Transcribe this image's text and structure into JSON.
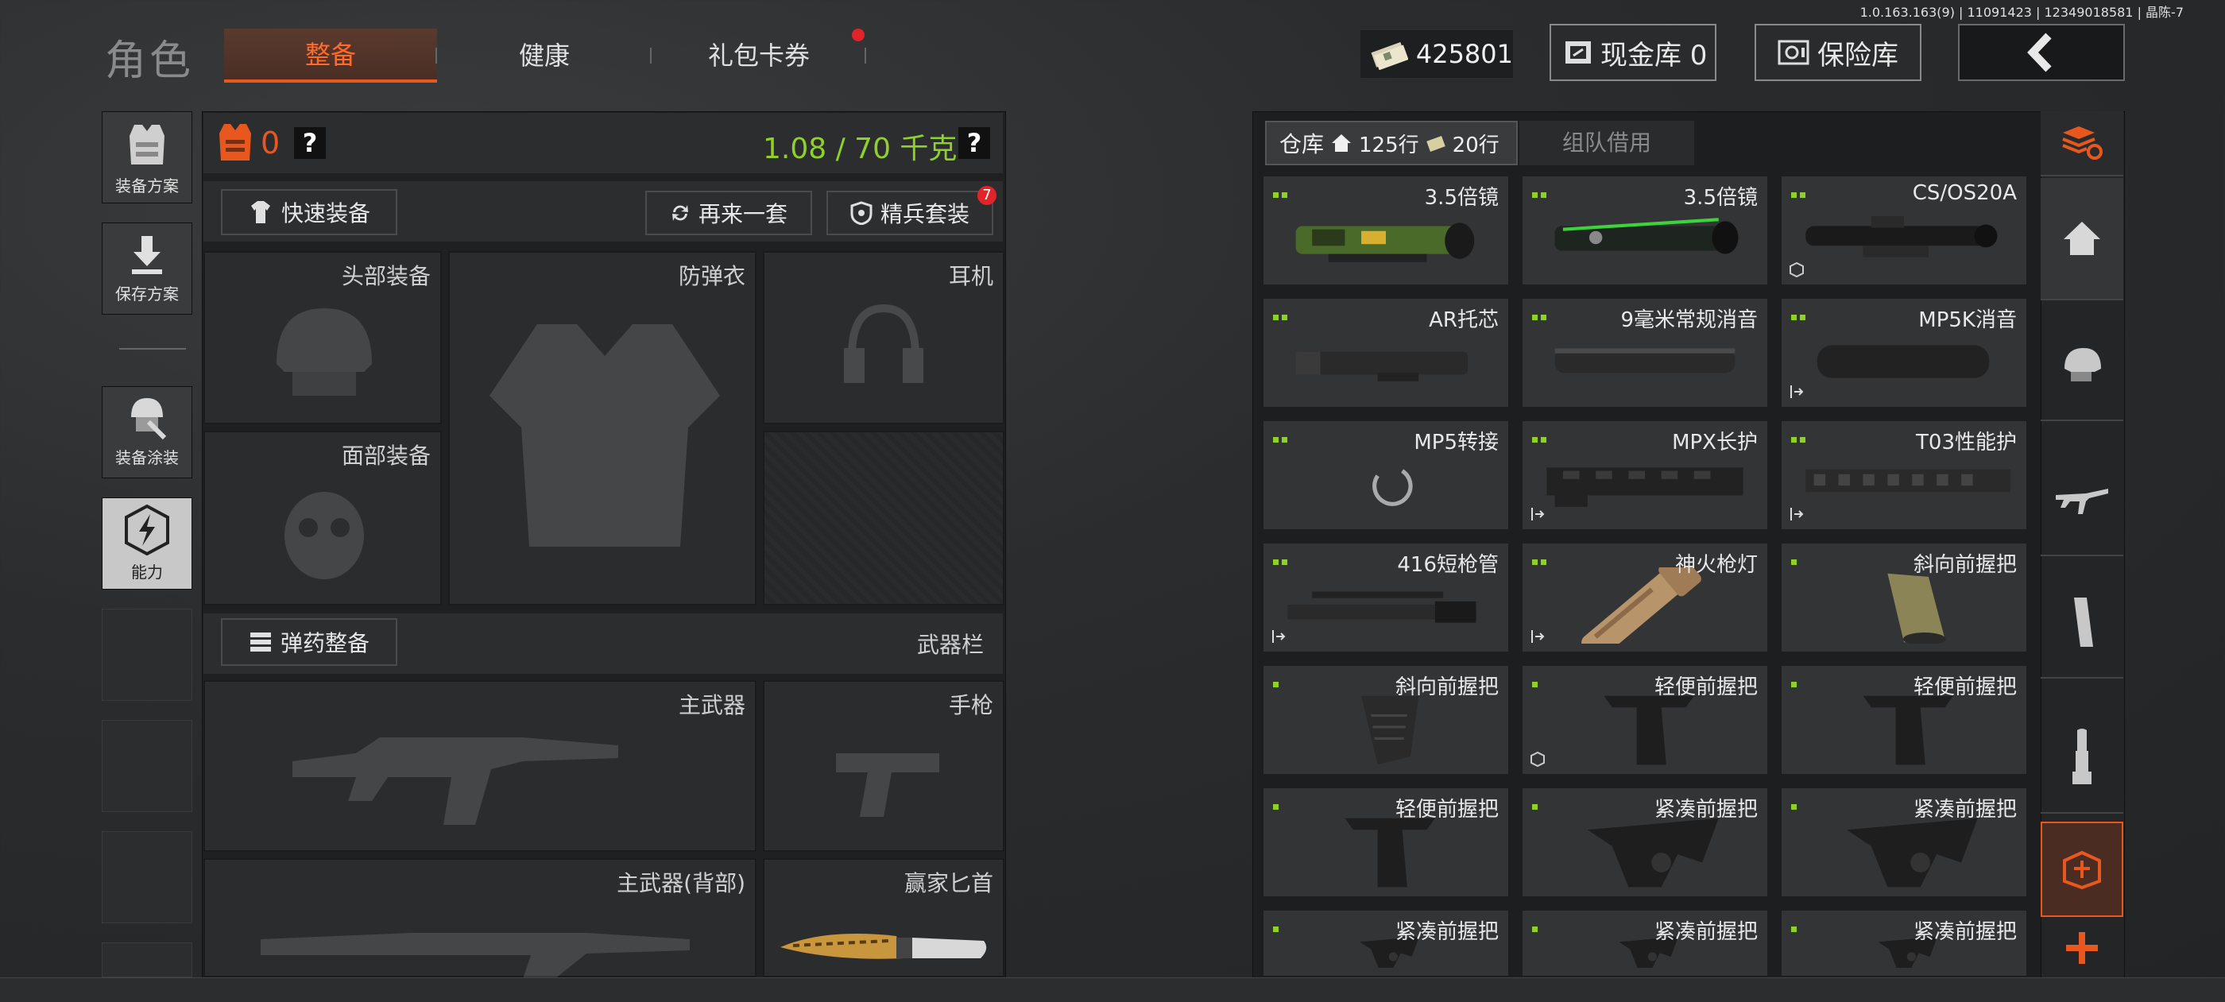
{
  "build_info": "1.0.163.163(9) | 11091423 | 12349018581 | 晶陈-7",
  "header": {
    "title": "角色",
    "tabs": [
      {
        "label": "整备",
        "active": true
      },
      {
        "label": "健康",
        "active": false
      },
      {
        "label": "礼包卡券",
        "active": false,
        "notification": true
      }
    ],
    "currency_value": "425801",
    "cash_vault_label": "现金库 0",
    "safe_label": "保险库"
  },
  "left_sidebar": [
    {
      "label": "装备方案",
      "icon": "vest-icon"
    },
    {
      "label": "保存方案",
      "icon": "download-icon"
    },
    {
      "label": "装备涂装",
      "icon": "helmet-paint-icon"
    },
    {
      "label": "能力",
      "icon": "lightning-icon"
    }
  ],
  "loadout": {
    "armor_count": "0",
    "help_glyph": "?",
    "weight": "1.08 / 70 千克",
    "quick_equip_label": "快速装备",
    "again_label": "再来一套",
    "elite_label": "精兵套装",
    "elite_badge": "7",
    "slots": {
      "head": "头部装备",
      "armor": "防弹衣",
      "headset": "耳机",
      "face": "面部装备"
    },
    "ammo_label": "弹药整备",
    "weapons_bar_label": "武器栏",
    "weapon_slots": {
      "primary": "主武器",
      "pistol": "手枪",
      "primary_back": "主武器(背部)",
      "knife": "赢家匕首"
    }
  },
  "inventory": {
    "tabs": [
      {
        "label": "仓库",
        "active": true
      },
      {
        "label": "组队借用",
        "active": false
      }
    ],
    "rows_home": "125行",
    "rows_extra": "20行",
    "items": [
      {
        "name": "3.5倍镜",
        "dots": 2,
        "art": "scope-camo"
      },
      {
        "name": "3.5倍镜",
        "dots": 2,
        "art": "scope-green"
      },
      {
        "name": "CS/OS20A",
        "dots": 2,
        "art": "scope-black",
        "corner": "box"
      },
      {
        "name": "AR托芯",
        "dots": 2,
        "art": "tube"
      },
      {
        "name": "9毫米常规消音",
        "dots": 2,
        "art": "suppressor"
      },
      {
        "name": "MP5K消音",
        "dots": 2,
        "art": "suppressor-fat",
        "corner": "exit"
      },
      {
        "name": "MP5转接",
        "dots": 2,
        "art": "loading"
      },
      {
        "name": "MPX长护",
        "dots": 2,
        "art": "handguard",
        "corner": "exit"
      },
      {
        "name": "T03性能护",
        "dots": 2,
        "art": "handguard-long",
        "corner": "exit"
      },
      {
        "name": "416短枪管",
        "dots": 2,
        "art": "barrel",
        "corner": "exit"
      },
      {
        "name": "神火枪灯",
        "dots": 2,
        "art": "flashlight",
        "corner": "exit"
      },
      {
        "name": "斜向前握把",
        "dots": 1,
        "art": "grip-tan"
      },
      {
        "name": "斜向前握把",
        "dots": 1,
        "art": "grip-angled"
      },
      {
        "name": "轻便前握把",
        "dots": 1,
        "art": "grip-light",
        "corner": "box"
      },
      {
        "name": "轻便前握把",
        "dots": 1,
        "art": "grip-light"
      },
      {
        "name": "轻便前握把",
        "dots": 1,
        "art": "grip-light"
      },
      {
        "name": "紧凑前握把",
        "dots": 1,
        "art": "grip-compact"
      },
      {
        "name": "紧凑前握把",
        "dots": 1,
        "art": "grip-compact"
      },
      {
        "name": "紧凑前握把",
        "dots": 1,
        "art": "grip-compact"
      },
      {
        "name": "紧凑前握把",
        "dots": 1,
        "art": "grip-compact"
      },
      {
        "name": "紧凑前握把",
        "dots": 1,
        "art": "grip-compact"
      }
    ]
  },
  "right_rail": [
    {
      "icon": "stack-refresh-icon"
    },
    {
      "icon": "home-icon"
    },
    {
      "icon": "helmet-icon"
    },
    {
      "icon": "rifle-icon"
    },
    {
      "icon": "magazine-icon"
    },
    {
      "icon": "ammo-icon"
    },
    {
      "icon": "medkit-icon",
      "active": true
    },
    {
      "icon": "plus-icon"
    }
  ],
  "colors": {
    "accent_orange": "#e8581e",
    "weight_green": "#8fd12a",
    "badge_red": "#e0242a"
  }
}
